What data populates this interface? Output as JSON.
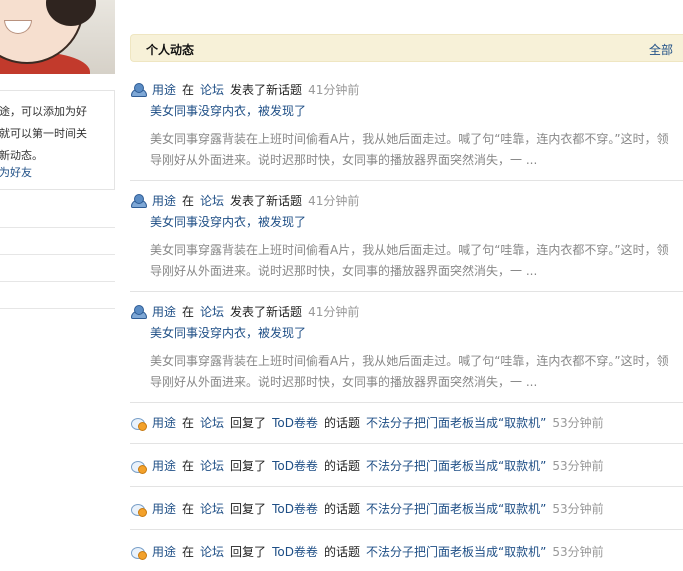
{
  "sidebar": {
    "tip_lines": [
      "途，可以添加为好",
      "就可以第一时间关",
      "新动态。"
    ],
    "tip_link": "为好友"
  },
  "header": {
    "title": "个人动态",
    "all_label": "全部"
  },
  "feed": {
    "posts": [
      {
        "user": "用途",
        "in_word": "在",
        "forum": "论坛",
        "action": "发表了新话题",
        "time": "41分钟前",
        "title": "美女同事没穿内衣，被发现了",
        "summary_1": "美女同事穿露背装在上班时间偷看A片，我从她后面走过。喊了句“哇靠，连内衣都不穿。”这时，领",
        "summary_2": "导刚好从外面进来。说时迟那时快，女同事的播放器界面突然消失，一 ..."
      },
      {
        "user": "用途",
        "in_word": "在",
        "forum": "论坛",
        "action": "发表了新话题",
        "time": "41分钟前",
        "title": "美女同事没穿内衣，被发现了",
        "summary_1": "美女同事穿露背装在上班时间偷看A片，我从她后面走过。喊了句“哇靠，连内衣都不穿。”这时，领",
        "summary_2": "导刚好从外面进来。说时迟那时快，女同事的播放器界面突然消失，一 ..."
      },
      {
        "user": "用途",
        "in_word": "在",
        "forum": "论坛",
        "action": "发表了新话题",
        "time": "41分钟前",
        "title": "美女同事没穿内衣，被发现了",
        "summary_1": "美女同事穿露背装在上班时间偷看A片，我从她后面走过。喊了句“哇靠，连内衣都不穿。”这时，领",
        "summary_2": "导刚好从外面进来。说时迟那时快，女同事的播放器界面突然消失，一 ..."
      }
    ],
    "replies": [
      {
        "user": "用途",
        "in_word": "在",
        "forum": "论坛",
        "action": "回复了",
        "author": "ToD卷卷",
        "of_topic": "的话题",
        "topic": "不法分子把门面老板当成“取款机”",
        "time": "53分钟前"
      },
      {
        "user": "用途",
        "in_word": "在",
        "forum": "论坛",
        "action": "回复了",
        "author": "ToD卷卷",
        "of_topic": "的话题",
        "topic": "不法分子把门面老板当成“取款机”",
        "time": "53分钟前"
      },
      {
        "user": "用途",
        "in_word": "在",
        "forum": "论坛",
        "action": "回复了",
        "author": "ToD卷卷",
        "of_topic": "的话题",
        "topic": "不法分子把门面老板当成“取款机”",
        "time": "53分钟前"
      },
      {
        "user": "用途",
        "in_word": "在",
        "forum": "论坛",
        "action": "回复了",
        "author": "ToD卷卷",
        "of_topic": "的话题",
        "topic": "不法分子把门面老板当成“取款机”",
        "time": "53分钟前"
      }
    ]
  }
}
